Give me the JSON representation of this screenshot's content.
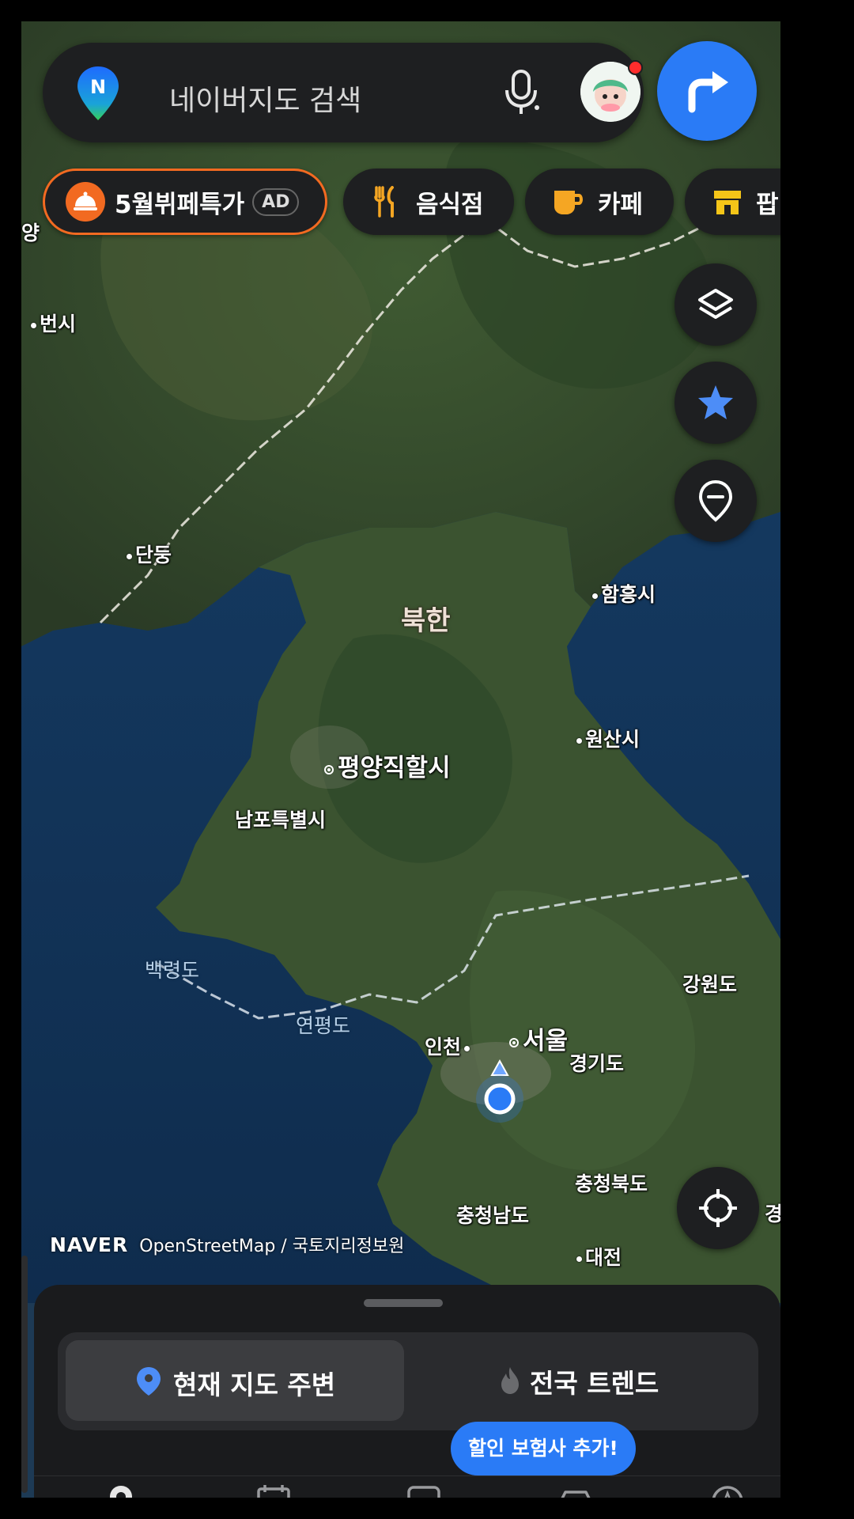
{
  "search": {
    "placeholder": "네이버지도 검색"
  },
  "chips": [
    {
      "label": "5월뷔페특가",
      "badge": "AD"
    },
    {
      "label": "음식점"
    },
    {
      "label": "카페"
    },
    {
      "label": "팝"
    }
  ],
  "map": {
    "places": {
      "yang": "양",
      "beonsi": "번시",
      "dandong": "단둥",
      "bukhan": "북한",
      "hamheung": "함흥시",
      "wonsan": "원산시",
      "pyongyang": "평양직할시",
      "nampo": "남포특별시",
      "baengnyeong": "백령도",
      "gangwon": "강원도",
      "yeonpyeong": "연평도",
      "incheon": "인천",
      "seoul": "서울",
      "gyeonggi": "경기도",
      "chungbuk": "충청북도",
      "chungnam": "충청남도",
      "daejeon": "대전",
      "edge_gyeong": "경"
    },
    "credits": {
      "brand": "NAVER",
      "sources": "OpenStreetMap / 국토지리정보원"
    }
  },
  "sheet": {
    "tab_nearby": "현재 지도 주변",
    "tab_trend": "전국 트렌드",
    "tooltip": "할인 보험사 추가!"
  },
  "icons": {
    "route": "turn-right-arrow-icon",
    "layers": "layers-icon",
    "favorites": "star-icon",
    "place": "location-pin-icon",
    "locate": "crosshair-icon"
  },
  "colors": {
    "accent": "#2a7bf6",
    "ad_border": "#f26a21",
    "surface": "#1e1f21"
  }
}
